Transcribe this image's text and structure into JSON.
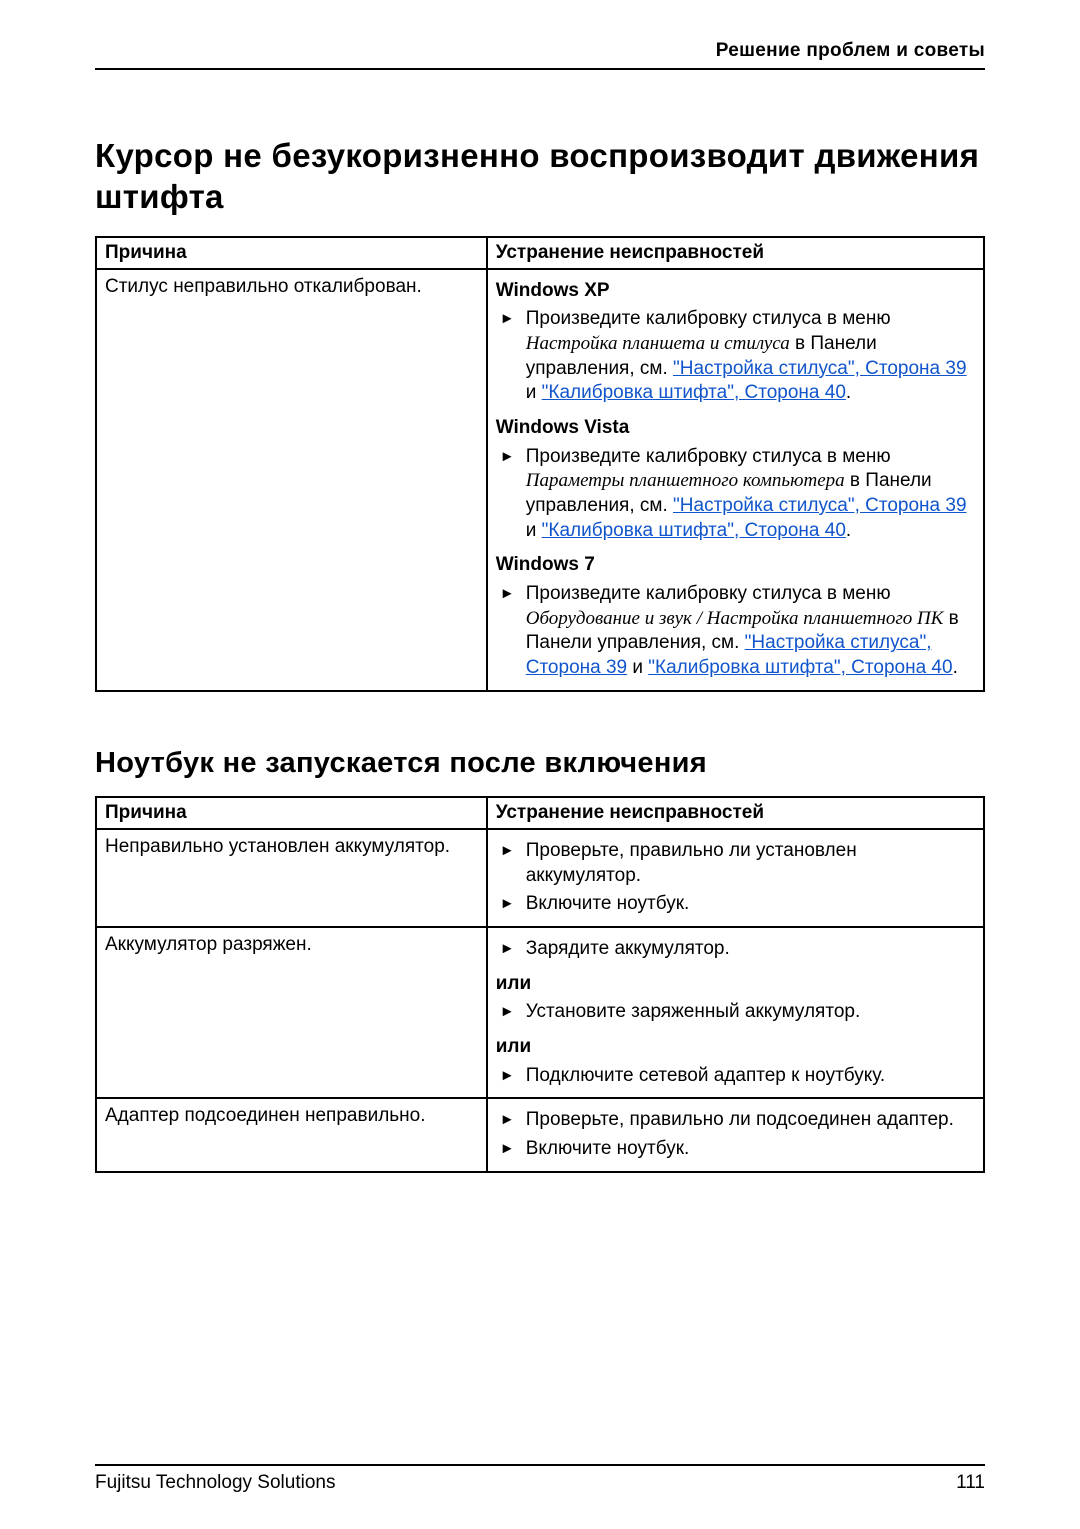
{
  "header": {
    "section": "Решение проблем и советы"
  },
  "section1": {
    "title": "Курсор не безукоризненно воспроизводит движения штифта",
    "col_cause": "Причина",
    "col_fix": "Устранение неисправностей",
    "cause": "Стилус неправильно откалиброван.",
    "xp_h": "Windows XP",
    "xp_pre": "Произведите калибровку стилуса в меню ",
    "xp_it": "Настройка планшета и стилуса",
    "xp_mid": " в Панели управления, см. ",
    "xp_l1": "\"Настройка стилуса\", Сторона 39",
    "xp_and": " и ",
    "xp_l2": "\"Калибровка штифта\", Сторона 40",
    "xp_dot": ".",
    "vista_h": "Windows Vista",
    "vista_pre": "Произведите калибровку стилуса в меню ",
    "vista_it": "Параметры планшетного компьютера",
    "vista_mid": " в Панели управления, см. ",
    "vista_l1": "\"Настройка стилуса\", Сторона 39",
    "vista_and": " и ",
    "vista_l2": "\"Калибровка штифта\", Сторона 40",
    "vista_dot": ".",
    "w7_h": "Windows 7",
    "w7_pre": "Произведите калибровку стилуса в меню ",
    "w7_it": "Оборудование и звук / Настройка планшетного ПК",
    "w7_mid": " в Панели управления, см. ",
    "w7_l1": "\"Настройка стилуса\", Сторона 39",
    "w7_and": " и ",
    "w7_l2": "\"Калибровка штифта\", Сторона 40",
    "w7_dot": "."
  },
  "section2": {
    "title": "Ноутбук не запускается после включения",
    "col_cause": "Причина",
    "col_fix": "Устранение неисправностей",
    "r1_cause": "Неправильно установлен аккумулятор.",
    "r1_a": "Проверьте, правильно ли установлен аккумулятор.",
    "r1_b": "Включите ноутбук.",
    "r2_cause": "Аккумулятор разряжен.",
    "r2_a": "Зарядите аккумулятор.",
    "or1": "или",
    "r2_b": "Установите заряженный аккумулятор.",
    "or2": "или",
    "r2_c": "Подключите сетевой адаптер к ноутбуку.",
    "r3_cause": "Адаптер подсоединен неправильно.",
    "r3_a": "Проверьте, правильно ли подсоединен адаптер.",
    "r3_b": "Включите ноутбук."
  },
  "footer": {
    "vendor": "Fujitsu Technology Solutions",
    "page": "111"
  }
}
